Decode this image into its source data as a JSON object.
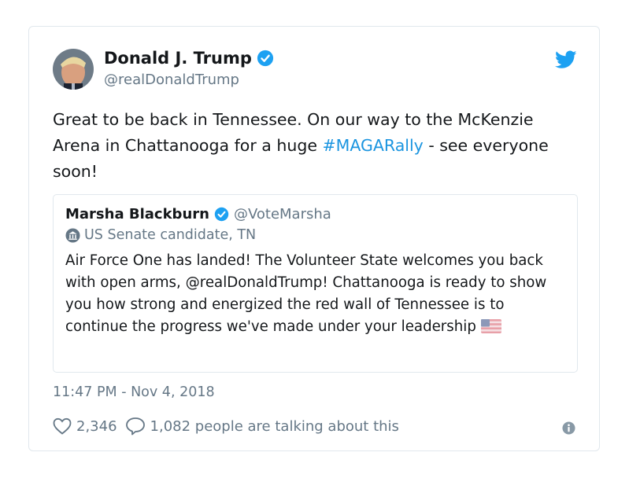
{
  "tweet": {
    "author_name": "Donald J. Trump",
    "author_handle": "@realDonaldTrump",
    "text_part1": "Great to be back in Tennessee. On our way to the McKenzie Arena in Chattanooga for a huge ",
    "hashtag": "#MAGARally",
    "text_part2": " - see everyone soon!",
    "timestamp": "11:47 PM - Nov 4, 2018",
    "likes": "2,346",
    "talking": "1,082 people are talking about this"
  },
  "quoted": {
    "author_name": "Marsha Blackburn",
    "author_handle": "@VoteMarsha",
    "label": "US Senate candidate, TN",
    "text": "Air Force One has landed! The Volunteer State welcomes you back with open arms, @realDonaldTrump! Chattanooga is ready to show you how strong and energized the red wall of Tennessee is to continue the progress we've made under your leadership"
  },
  "icons": {
    "brand": "twitter-bird-icon",
    "verified": "verified-badge-icon",
    "label": "government-building-icon",
    "like": "heart-icon",
    "reply": "speech-bubble-icon",
    "info": "info-icon",
    "emoji": "us-flag-icon"
  },
  "colors": {
    "accent": "#1da1f2",
    "hashtag": "#1b95e0",
    "muted": "#657786",
    "border": "#e1e8ed"
  }
}
